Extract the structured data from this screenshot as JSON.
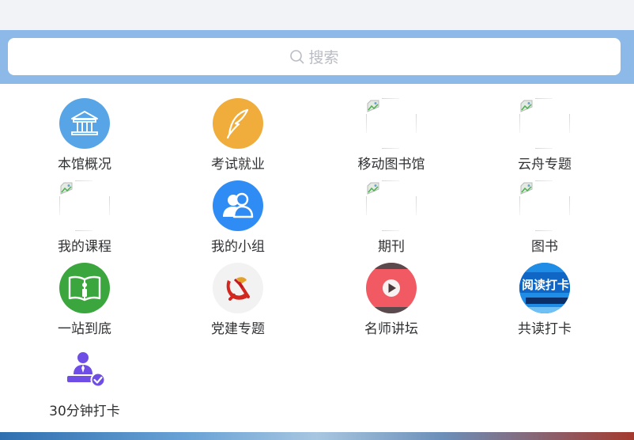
{
  "search": {
    "placeholder": "搜索"
  },
  "items": [
    {
      "label": "本馆概况",
      "icon": "library-building-icon",
      "color": "#57a5e6"
    },
    {
      "label": "考试就业",
      "icon": "quill-feather-icon",
      "color": "#f0ad3c"
    },
    {
      "label": "移动图书馆",
      "icon": "broken-image-icon"
    },
    {
      "label": "云舟专题",
      "icon": "broken-image-icon"
    },
    {
      "label": "我的课程",
      "icon": "broken-image-icon"
    },
    {
      "label": "我的小组",
      "icon": "group-users-icon",
      "color": "#2f8cf5"
    },
    {
      "label": "期刊",
      "icon": "broken-image-icon"
    },
    {
      "label": "图书",
      "icon": "broken-image-icon"
    },
    {
      "label": "一站到底",
      "icon": "open-book-info-icon",
      "color": "#3aa63d"
    },
    {
      "label": "党建专题",
      "icon": "party-emblem-icon",
      "color": "#f2f2f2"
    },
    {
      "label": "名师讲坛",
      "icon": "play-video-icon",
      "color": "#f25a63"
    },
    {
      "label": "共读打卡",
      "icon": "reading-checkin-icon",
      "color": "#1f8de6",
      "icon_text": "阅读打卡"
    },
    {
      "label": "30分钟打卡",
      "icon": "user-check-icon",
      "color": "#6f4ee6"
    }
  ]
}
